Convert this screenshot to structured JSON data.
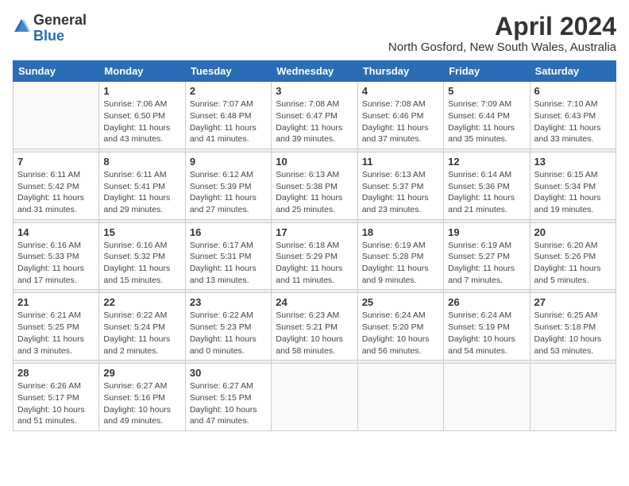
{
  "logo": {
    "general": "General",
    "blue": "Blue"
  },
  "title": "April 2024",
  "subtitle": "North Gosford, New South Wales, Australia",
  "days_of_week": [
    "Sunday",
    "Monday",
    "Tuesday",
    "Wednesday",
    "Thursday",
    "Friday",
    "Saturday"
  ],
  "weeks": [
    [
      {
        "day": "",
        "info": ""
      },
      {
        "day": "1",
        "info": "Sunrise: 7:06 AM\nSunset: 6:50 PM\nDaylight: 11 hours\nand 43 minutes."
      },
      {
        "day": "2",
        "info": "Sunrise: 7:07 AM\nSunset: 6:48 PM\nDaylight: 11 hours\nand 41 minutes."
      },
      {
        "day": "3",
        "info": "Sunrise: 7:08 AM\nSunset: 6:47 PM\nDaylight: 11 hours\nand 39 minutes."
      },
      {
        "day": "4",
        "info": "Sunrise: 7:08 AM\nSunset: 6:46 PM\nDaylight: 11 hours\nand 37 minutes."
      },
      {
        "day": "5",
        "info": "Sunrise: 7:09 AM\nSunset: 6:44 PM\nDaylight: 11 hours\nand 35 minutes."
      },
      {
        "day": "6",
        "info": "Sunrise: 7:10 AM\nSunset: 6:43 PM\nDaylight: 11 hours\nand 33 minutes."
      }
    ],
    [
      {
        "day": "7",
        "info": "Sunrise: 6:11 AM\nSunset: 5:42 PM\nDaylight: 11 hours\nand 31 minutes."
      },
      {
        "day": "8",
        "info": "Sunrise: 6:11 AM\nSunset: 5:41 PM\nDaylight: 11 hours\nand 29 minutes."
      },
      {
        "day": "9",
        "info": "Sunrise: 6:12 AM\nSunset: 5:39 PM\nDaylight: 11 hours\nand 27 minutes."
      },
      {
        "day": "10",
        "info": "Sunrise: 6:13 AM\nSunset: 5:38 PM\nDaylight: 11 hours\nand 25 minutes."
      },
      {
        "day": "11",
        "info": "Sunrise: 6:13 AM\nSunset: 5:37 PM\nDaylight: 11 hours\nand 23 minutes."
      },
      {
        "day": "12",
        "info": "Sunrise: 6:14 AM\nSunset: 5:36 PM\nDaylight: 11 hours\nand 21 minutes."
      },
      {
        "day": "13",
        "info": "Sunrise: 6:15 AM\nSunset: 5:34 PM\nDaylight: 11 hours\nand 19 minutes."
      }
    ],
    [
      {
        "day": "14",
        "info": "Sunrise: 6:16 AM\nSunset: 5:33 PM\nDaylight: 11 hours\nand 17 minutes."
      },
      {
        "day": "15",
        "info": "Sunrise: 6:16 AM\nSunset: 5:32 PM\nDaylight: 11 hours\nand 15 minutes."
      },
      {
        "day": "16",
        "info": "Sunrise: 6:17 AM\nSunset: 5:31 PM\nDaylight: 11 hours\nand 13 minutes."
      },
      {
        "day": "17",
        "info": "Sunrise: 6:18 AM\nSunset: 5:29 PM\nDaylight: 11 hours\nand 11 minutes."
      },
      {
        "day": "18",
        "info": "Sunrise: 6:19 AM\nSunset: 5:28 PM\nDaylight: 11 hours\nand 9 minutes."
      },
      {
        "day": "19",
        "info": "Sunrise: 6:19 AM\nSunset: 5:27 PM\nDaylight: 11 hours\nand 7 minutes."
      },
      {
        "day": "20",
        "info": "Sunrise: 6:20 AM\nSunset: 5:26 PM\nDaylight: 11 hours\nand 5 minutes."
      }
    ],
    [
      {
        "day": "21",
        "info": "Sunrise: 6:21 AM\nSunset: 5:25 PM\nDaylight: 11 hours\nand 3 minutes."
      },
      {
        "day": "22",
        "info": "Sunrise: 6:22 AM\nSunset: 5:24 PM\nDaylight: 11 hours\nand 2 minutes."
      },
      {
        "day": "23",
        "info": "Sunrise: 6:22 AM\nSunset: 5:23 PM\nDaylight: 11 hours\nand 0 minutes."
      },
      {
        "day": "24",
        "info": "Sunrise: 6:23 AM\nSunset: 5:21 PM\nDaylight: 10 hours\nand 58 minutes."
      },
      {
        "day": "25",
        "info": "Sunrise: 6:24 AM\nSunset: 5:20 PM\nDaylight: 10 hours\nand 56 minutes."
      },
      {
        "day": "26",
        "info": "Sunrise: 6:24 AM\nSunset: 5:19 PM\nDaylight: 10 hours\nand 54 minutes."
      },
      {
        "day": "27",
        "info": "Sunrise: 6:25 AM\nSunset: 5:18 PM\nDaylight: 10 hours\nand 53 minutes."
      }
    ],
    [
      {
        "day": "28",
        "info": "Sunrise: 6:26 AM\nSunset: 5:17 PM\nDaylight: 10 hours\nand 51 minutes."
      },
      {
        "day": "29",
        "info": "Sunrise: 6:27 AM\nSunset: 5:16 PM\nDaylight: 10 hours\nand 49 minutes."
      },
      {
        "day": "30",
        "info": "Sunrise: 6:27 AM\nSunset: 5:15 PM\nDaylight: 10 hours\nand 47 minutes."
      },
      {
        "day": "",
        "info": ""
      },
      {
        "day": "",
        "info": ""
      },
      {
        "day": "",
        "info": ""
      },
      {
        "day": "",
        "info": ""
      }
    ]
  ]
}
